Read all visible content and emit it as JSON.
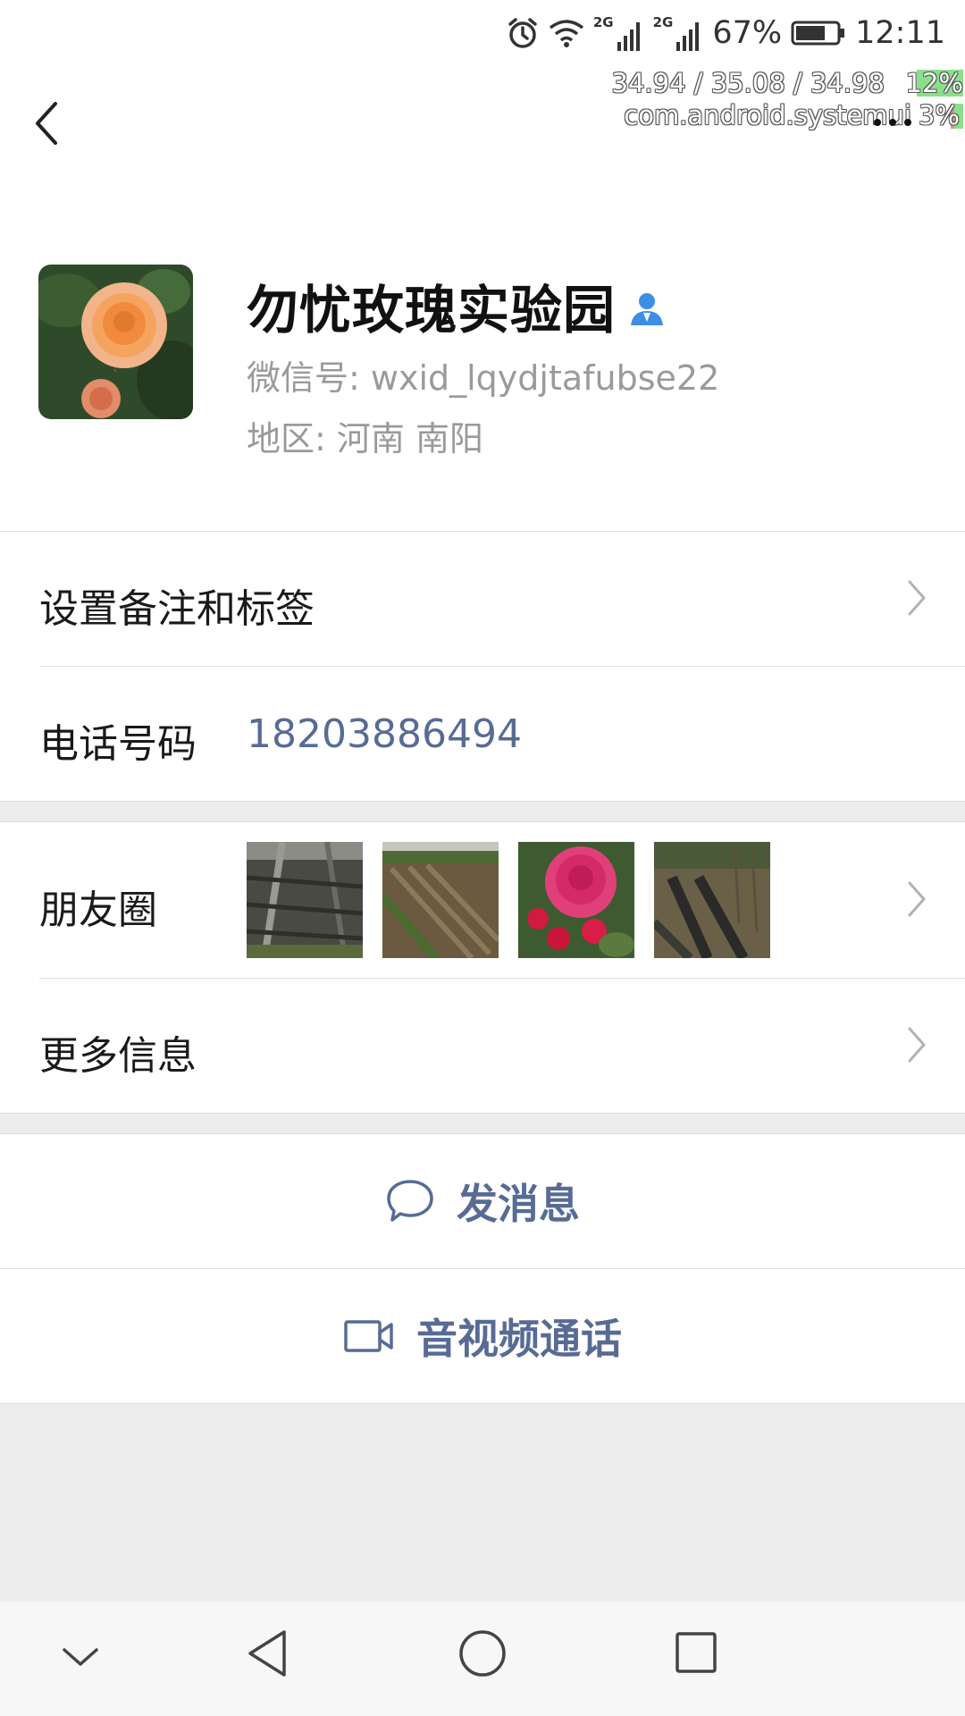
{
  "status_bar": {
    "network_tag_1": "2G",
    "network_tag_2": "2G",
    "battery_percent": "67%",
    "time": "12:11",
    "icons": [
      "alarm-icon",
      "wifi-icon",
      "signal-icon",
      "signal-icon",
      "battery-icon"
    ]
  },
  "debug_overlay": {
    "load": "34.94 / 35.08 / 34.98",
    "load_pct": "12%",
    "process": "com.android.systemui",
    "process_pct": "3%"
  },
  "profile": {
    "name": "勿忧玫瑰实验园",
    "wechat_id": "微信号: wxid_lqydjtafubse22",
    "region": "地区: 河南  南阳"
  },
  "rows": {
    "remark": "设置备注和标签",
    "phone_label": "电话号码",
    "phone_value": "18203886494",
    "moments": "朋友圈",
    "more_info": "更多信息"
  },
  "actions": {
    "message": "发消息",
    "video_call": "音视频通话"
  },
  "colors": {
    "link_blue": "#576b95",
    "secondary_gray": "#9a9a9a",
    "band_gray": "#ededed"
  }
}
